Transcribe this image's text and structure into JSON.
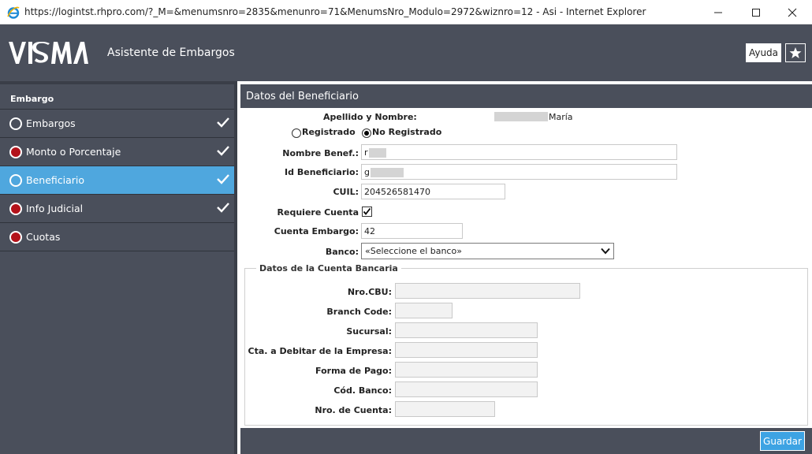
{
  "window": {
    "title": "https://logintst.rhpro.com/?_M=&menumsnro=2835&menunro=71&MenumsNro_Modulo=2972&wiznro=12 - Asi - Internet Explorer",
    "minimize_icon": "minimize-icon",
    "maximize_icon": "maximize-icon",
    "close_icon": "close-icon"
  },
  "header": {
    "logo": "VISMA",
    "app_title": "Asistente de Embargos",
    "help_label": "Ayuda",
    "favorite_icon": "star-icon"
  },
  "sidebar": {
    "section_title": "Embargo",
    "items": [
      {
        "label": "Embargos",
        "status": "open-circle",
        "done": true
      },
      {
        "label": "Monto o Porcentaje",
        "status": "red",
        "done": true
      },
      {
        "label": "Beneficiario",
        "status": "open-circle",
        "done": true,
        "active": true
      },
      {
        "label": "Info Judicial",
        "status": "red",
        "done": true
      },
      {
        "label": "Cuotas",
        "status": "red",
        "done": false
      }
    ]
  },
  "main": {
    "panel_title": "Datos del Beneficiario",
    "apellido_label": "Apellido y Nombre:",
    "apellido_value": "María",
    "radio_registrado": "Registrado",
    "radio_no_registrado": "No Registrado",
    "radio_selected": "No Registrado",
    "nombre_label": "Nombre Benef.:",
    "nombre_value": "r",
    "id_label": "Id Beneficiario:",
    "id_value": "g",
    "cuil_label": "CUIL:",
    "cuil_value": "204526581470",
    "requiere_label": "Requiere Cuenta",
    "requiere_checked": true,
    "cuenta_label": "Cuenta Embargo:",
    "cuenta_value": "42",
    "banco_label": "Banco:",
    "banco_value": "«Seleccione el banco»",
    "bank_section": {
      "legend": "Datos de la Cuenta Bancaria",
      "cbu_label": "Nro.CBU:",
      "branch_label": "Branch Code:",
      "sucursal_label": "Sucursal:",
      "cta_label": "Cta. a Debitar de la Empresa:",
      "forma_label": "Forma de Pago:",
      "cod_label": "Cód. Banco:",
      "nro_cuenta_label": "Nro. de Cuenta:"
    },
    "save_label": "Guardar"
  },
  "colors": {
    "header_bg": "#4a4f5b",
    "active_item": "#4fa7de",
    "status_red": "#b3121a",
    "save_button": "#3da3e3"
  }
}
